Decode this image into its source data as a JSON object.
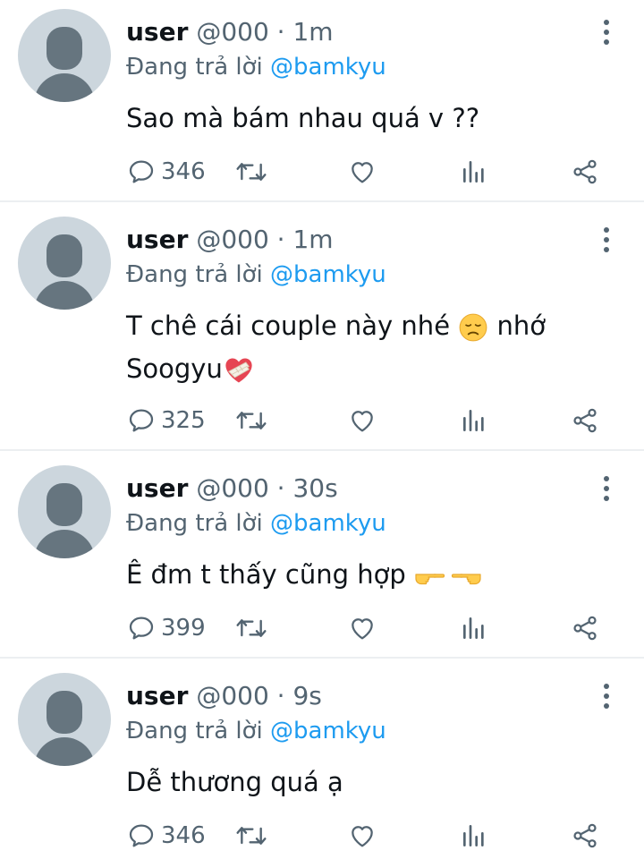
{
  "colors": {
    "accent": "#1d9bf0",
    "secondary_text": "#536471",
    "avatar_bg": "#ccd6dd",
    "avatar_fg": "#66757f"
  },
  "icons": {
    "reply": "reply-icon",
    "retweet": "retweet-icon",
    "like": "heart-icon",
    "views": "analytics-icon",
    "share": "share-icon",
    "more": "more-vertical-icon"
  },
  "tweets": [
    {
      "name": "user",
      "handle": "@000",
      "time": "1m",
      "reply_prefix": "Đang trả lời",
      "reply_to": "@bamkyu",
      "text_lines": [
        "Sao mà bám nhau quá v ??"
      ],
      "replies": "346"
    },
    {
      "name": "user",
      "handle": "@000",
      "time": "1m",
      "reply_prefix": "Đang trả lời",
      "reply_to": "@bamkyu",
      "text_lines": [
        "T chê cái couple này nhé",
        "nhớ",
        "Soogyu"
      ],
      "emojis": [
        "disappointed-face",
        "mending-heart"
      ],
      "replies": "325"
    },
    {
      "name": "user",
      "handle": "@000",
      "time": "30s",
      "reply_prefix": "Đang trả lời",
      "reply_to": "@bamkyu",
      "text_lines": [
        "Ê đm t thấy cũng hợp"
      ],
      "emojis": [
        "pointing-right",
        "pointing-left"
      ],
      "replies": "399"
    },
    {
      "name": "user",
      "handle": "@000",
      "time": "9s",
      "reply_prefix": "Đang trả lời",
      "reply_to": "@bamkyu",
      "text_lines": [
        "Dễ thương quá ạ"
      ],
      "replies": "346"
    }
  ]
}
